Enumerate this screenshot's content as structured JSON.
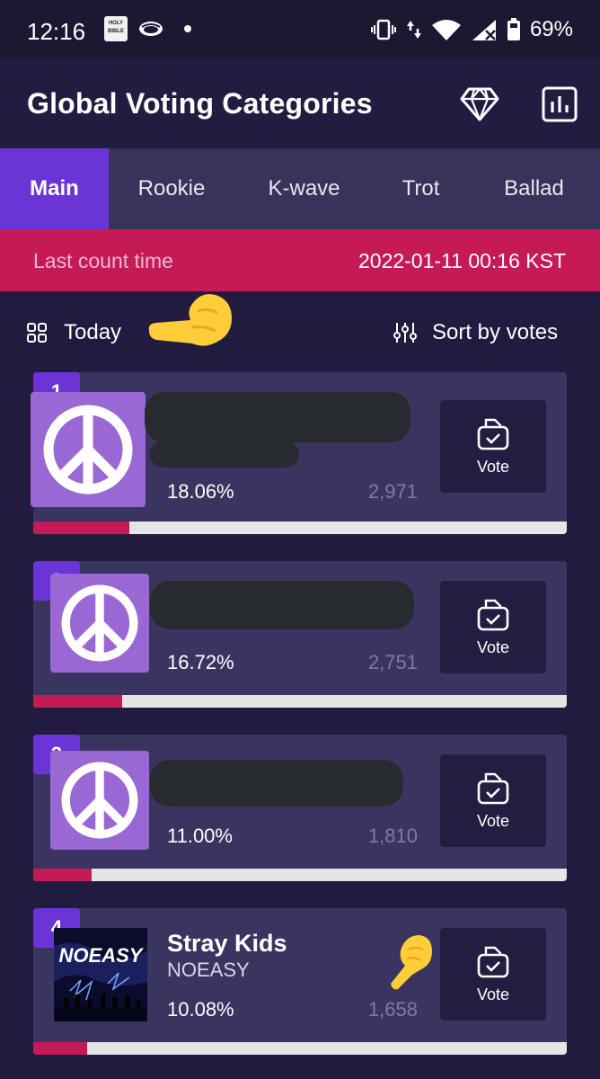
{
  "status_bar": {
    "time": "12:16",
    "bible_icon_text": "HOLY BIBLE",
    "battery": "69%"
  },
  "header": {
    "title": "Global Voting Categories",
    "icons": [
      "diamond-icon",
      "chart-icon"
    ]
  },
  "tabs": [
    {
      "label": "Main",
      "active": true
    },
    {
      "label": "Rookie",
      "active": false
    },
    {
      "label": "K-wave",
      "active": false
    },
    {
      "label": "Trot",
      "active": false
    },
    {
      "label": "Ballad",
      "active": false
    }
  ],
  "count_bar": {
    "label": "Last count time",
    "value": "2022-01-11 00:16 KST"
  },
  "filters": {
    "period": "Today",
    "sort": "Sort by votes"
  },
  "entries": [
    {
      "rank": "1",
      "name": "",
      "subtitle": "",
      "percent": "18.06%",
      "votes": "2,971",
      "progress": 0.1806,
      "vote_label": "Vote",
      "image": "peace-icon"
    },
    {
      "rank": "2",
      "name": "",
      "subtitle": "",
      "percent": "16.72%",
      "votes": "2,751",
      "progress": 0.1672,
      "vote_label": "Vote",
      "image": "peace-icon"
    },
    {
      "rank": "3",
      "name": "",
      "subtitle": "",
      "percent": "11.00%",
      "votes": "1,810",
      "progress": 0.11,
      "vote_label": "Vote",
      "image": "peace-icon"
    },
    {
      "rank": "4",
      "name": "Stray Kids",
      "subtitle": "NOEASY",
      "percent": "10.08%",
      "votes": "1,658",
      "progress": 0.1008,
      "vote_label": "Vote",
      "image": "album-cover"
    }
  ],
  "album_cover_text": "NOEASY",
  "colors": {
    "background": "#211c3f",
    "accent": "#6a34d6",
    "count_bar": "#c51a55",
    "card": "#3a3560"
  }
}
